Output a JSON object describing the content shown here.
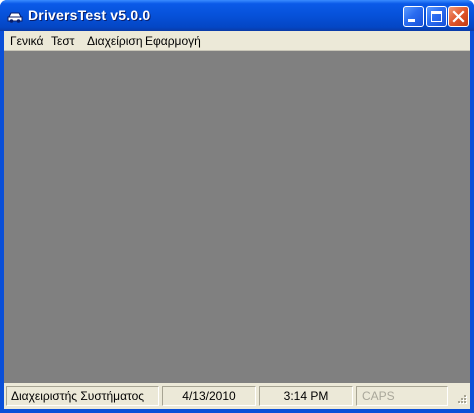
{
  "window": {
    "title": "DriversTest v5.0.0"
  },
  "menu": {
    "items": [
      "Γενικά",
      "Τεστ",
      "Διαχείριση",
      "Εφαρμογή"
    ]
  },
  "statusbar": {
    "user": "Διαχειριστής Συστήματος",
    "date": "4/13/2010",
    "time": "3:14 PM",
    "caps": "CAPS"
  },
  "colors": {
    "titlebar": "#0651d9",
    "mdi_background": "#808080",
    "chrome": "#ece9d8"
  }
}
